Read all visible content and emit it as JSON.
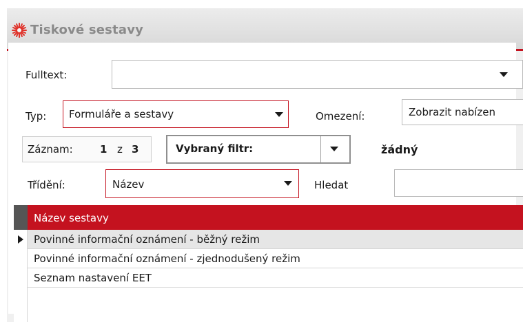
{
  "window": {
    "title": "Tiskové sestavy",
    "icon": "red-sparkle-icon"
  },
  "filters": {
    "fulltext_label": "Fulltext:",
    "fulltext_value": "",
    "typ_label": "Typ:",
    "typ_value": "Formuláře a sestavy",
    "omezeni_label": "Omezení:",
    "omezeni_value": "Zobrazit nabízen",
    "record_label": "Záznam:",
    "record_current": "1",
    "record_sep": "z",
    "record_total": "3",
    "filter_label": "Vybraný filtr:",
    "filter_value": "žádný",
    "sort_label": "Třídění:",
    "sort_value": "Název",
    "search_label": "Hledat",
    "search_value": ""
  },
  "grid": {
    "column_header": "Název sestavy",
    "rows": [
      "Povinné informační oznámení - běžný režim",
      "Povinné informační oznámení - zjednodušený režim",
      "Seznam nastavení EET"
    ],
    "current_row": 0
  },
  "colors": {
    "accent": "#c4121f",
    "header_text": "#ffffff"
  }
}
